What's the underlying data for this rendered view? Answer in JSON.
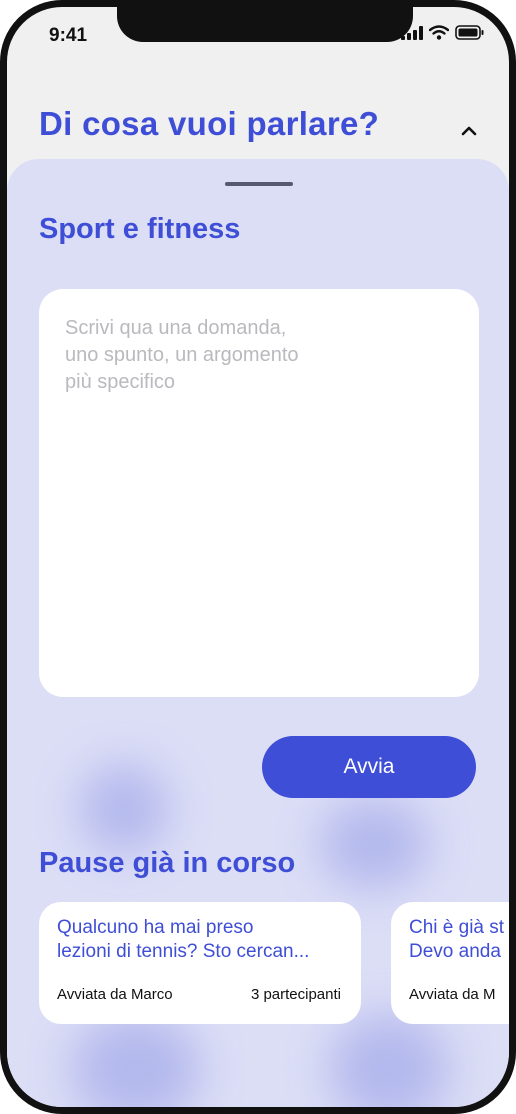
{
  "status_bar": {
    "time": "9:41"
  },
  "header": {
    "title": "Di cosa vuoi parlare?",
    "toggle_icon": "chevron-up-icon"
  },
  "sheet": {
    "topic": "Sport e fitness",
    "question_placeholder": "Scrivi qua una domanda,\nuno spunto, un argomento\npiù specifico",
    "start_label": "Avvia",
    "ongoing_title": "Pause già in corso",
    "cards": [
      {
        "text": "Qualcuno ha mai preso\nlezioni di tennis? Sto cercan...",
        "author": "Avviata da Marco",
        "participants": "3 partecipanti"
      },
      {
        "text": "Chi è già st\nDevo anda",
        "author": "Avviata da M",
        "participants": ""
      }
    ]
  },
  "colors": {
    "accent": "#3f4ed6",
    "sheet_background": "#dcdef6",
    "page_background": "#f0f0f0"
  }
}
